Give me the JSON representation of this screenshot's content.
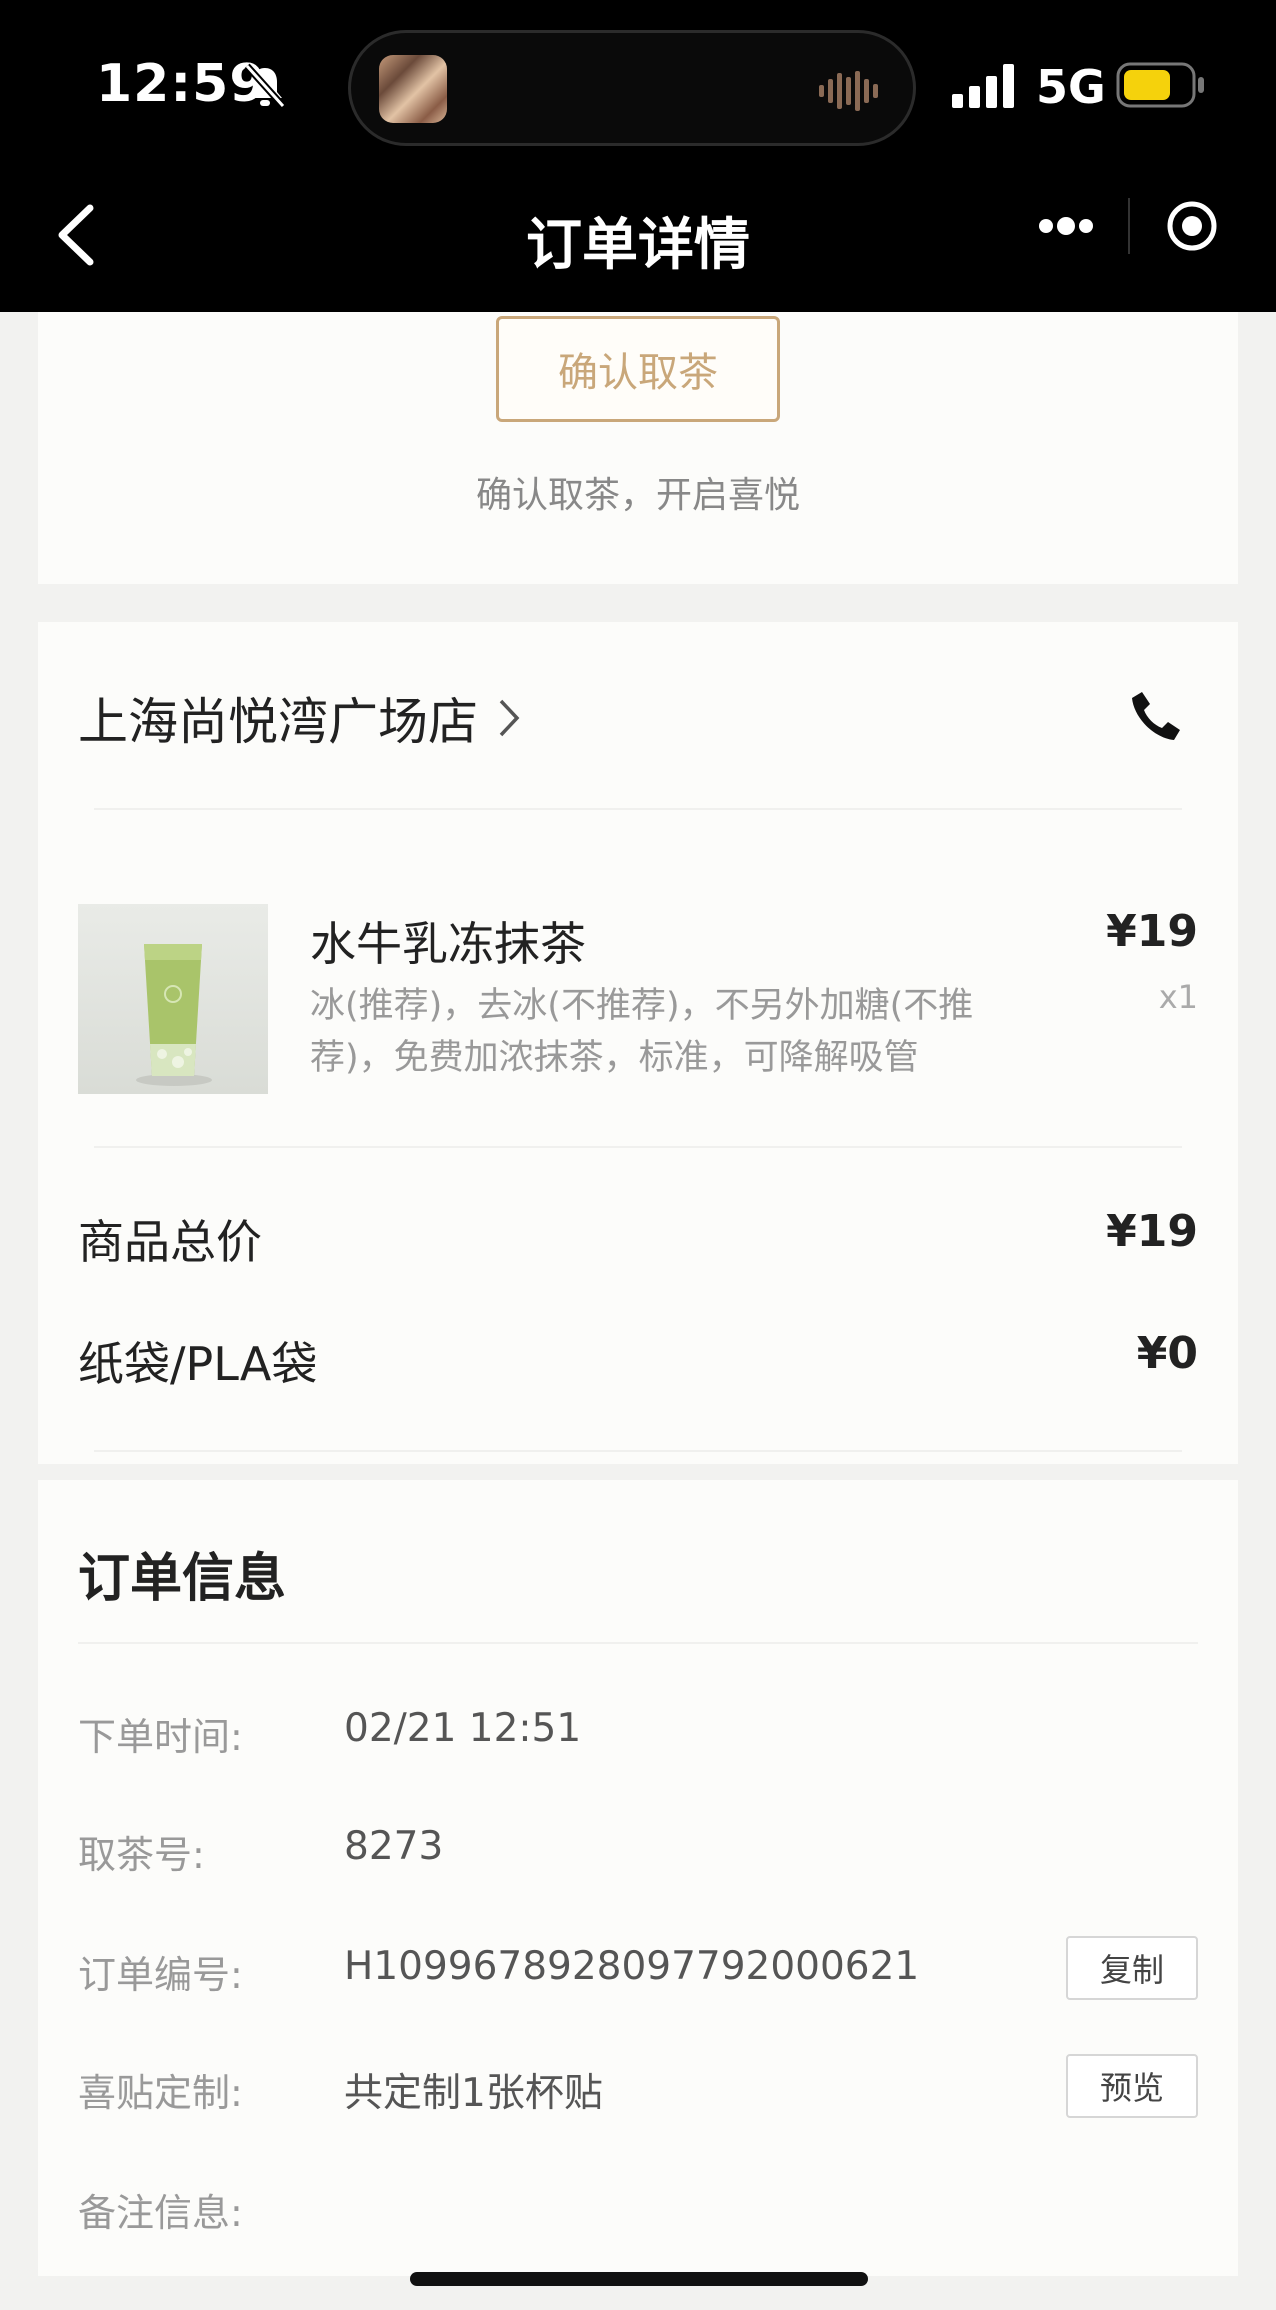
{
  "status_bar": {
    "time": "12:59",
    "network": "5G"
  },
  "nav": {
    "title": "订单详情"
  },
  "pickup": {
    "button_label": "确认取茶",
    "tip": "确认取茶，开启喜悦"
  },
  "store": {
    "name": "上海尚悦湾广场店"
  },
  "product": {
    "name": "水牛乳冻抹茶",
    "spec": "冰(推荐)，去冰(不推荐)，不另外加糖(不推荐)，免费加浓抹茶，标准，可降解吸管",
    "price": "¥19",
    "qty": "x1"
  },
  "totals": [
    {
      "label": "商品总价",
      "value": "¥19"
    },
    {
      "label": "纸袋/PLA袋",
      "value": "¥0"
    }
  ],
  "order_info": {
    "title": "订单信息",
    "rows": [
      {
        "label": "下单时间:",
        "value": "02/21 12:51"
      },
      {
        "label": "取茶号:",
        "value": "8273"
      },
      {
        "label": "订单编号:",
        "value": "H1099678928097792000621",
        "action": "复制"
      },
      {
        "label": "喜贴定制:",
        "value": "共定制1张杯贴",
        "action": "预览"
      },
      {
        "label": "备注信息:",
        "value": ""
      }
    ]
  },
  "colors": {
    "accent": "#c9a77a",
    "topbar": "#000000",
    "battery": "#f5d20c",
    "matcha": "#a9c46a"
  }
}
